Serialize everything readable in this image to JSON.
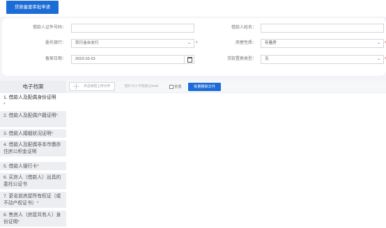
{
  "top_tab": {
    "label": "贷款备案审批申请"
  },
  "form": {
    "id_number": {
      "label": "借款人证件号码：",
      "value": ""
    },
    "borrower_name": {
      "label": "借款人姓名：",
      "value": ""
    },
    "bank": {
      "label": "委托银行：",
      "value": "农行金台支行",
      "required": "*"
    },
    "house_type": {
      "label": "房屋性质：",
      "value": "存量房",
      "required": "*"
    },
    "record_date": {
      "label": "备案日期：",
      "value": "2023-10-23"
    },
    "loan_type": {
      "label": "贷款置换类型：",
      "value": "无",
      "required": "*"
    }
  },
  "archive": {
    "header": "电子档案",
    "upload_label": "点击按钮上传文件",
    "size_note": "图片大小不能超过5MB",
    "select_all_label": "全选",
    "batch_delete_label": "批量删除文件",
    "items": [
      {
        "label": "1. 借款人及配偶身份证明",
        "star": "*"
      },
      {
        "label": "2. 借款人及配偶户籍证明",
        "star": "*"
      },
      {
        "label": "3. 借款人婚姻状况证明",
        "star": "*"
      },
      {
        "label": "4. 借款人及配偶非本市缴存住房公积金证明",
        "star": ""
      },
      {
        "label": "5. 借款人银行卡",
        "star": "*"
      },
      {
        "label": "6. 买房人（借款人）出具的委托公证书",
        "star": ""
      },
      {
        "label": "7. 更名前房屋所有权证（或不动产权证书）",
        "star": "*"
      },
      {
        "label": "8. 售房人（房屋共有人）身份证明",
        "star": "*"
      }
    ]
  }
}
